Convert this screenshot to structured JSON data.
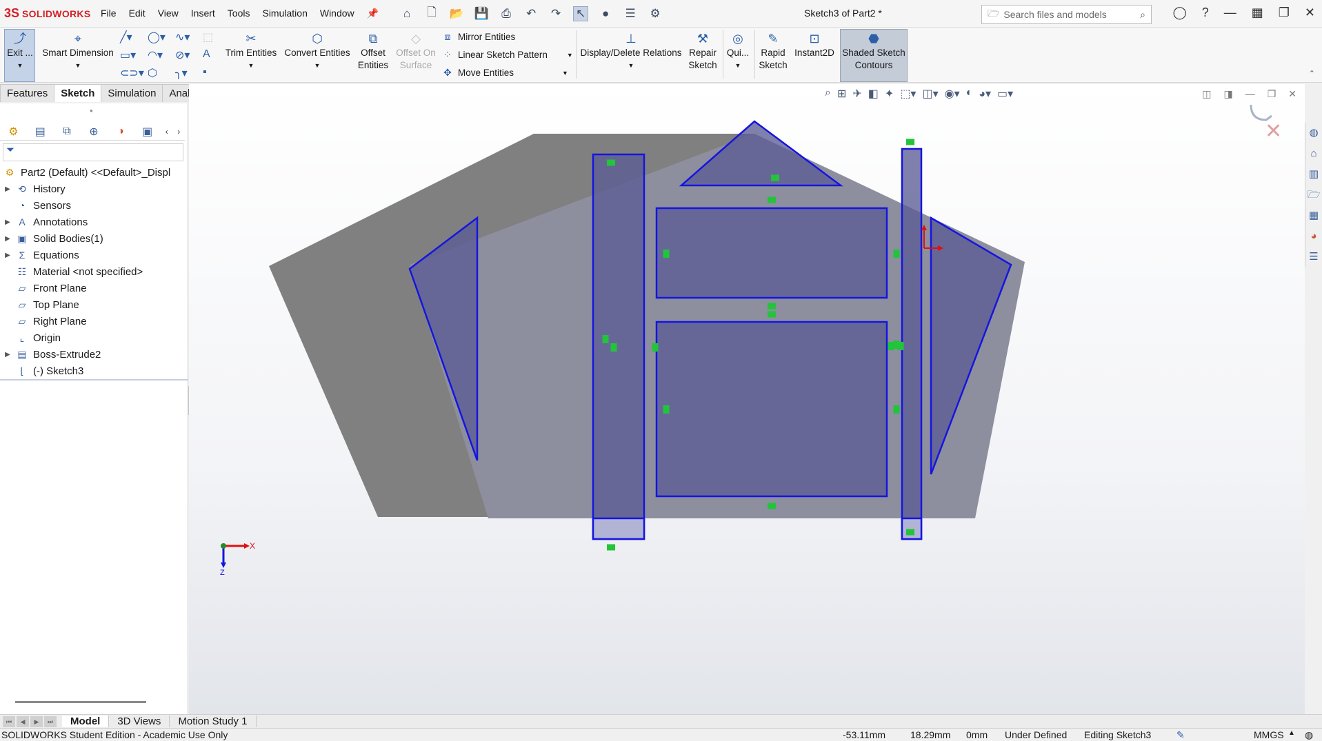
{
  "app": {
    "logo_mark": "3S",
    "logo_text": "SOLIDWORKS",
    "document_title": "Sketch3 of Part2 *"
  },
  "menu": [
    "File",
    "Edit",
    "View",
    "Insert",
    "Tools",
    "Simulation",
    "Window"
  ],
  "search": {
    "placeholder": "Search files and models"
  },
  "commands": {
    "exit": "Exit ...",
    "smart_dimension": "Smart Dimension",
    "trim_entities": "Trim Entities",
    "convert_entities": "Convert Entities",
    "offset_entities_1": "Offset",
    "offset_entities_2": "Entities",
    "offset_on_surface_1": "Offset On",
    "offset_on_surface_2": "Surface",
    "mirror_entities": "Mirror Entities",
    "linear_sketch_pattern": "Linear Sketch Pattern",
    "move_entities": "Move Entities",
    "display_delete_relations": "Display/Delete Relations",
    "repair_sketch_1": "Repair",
    "repair_sketch_2": "Sketch",
    "quick_snaps": "Qui...",
    "rapid_sketch_1": "Rapid",
    "rapid_sketch_2": "Sketch",
    "instant2d": "Instant2D",
    "shaded_contours_1": "Shaded Sketch",
    "shaded_contours_2": "Contours"
  },
  "tabs": [
    "Features",
    "Sketch",
    "Simulation",
    "Analysis Preparation"
  ],
  "active_tab": "Sketch",
  "tree": {
    "root": "Part2 (Default) <<Default>_Displ",
    "items": [
      {
        "label": "History",
        "expandable": true
      },
      {
        "label": "Sensors",
        "expandable": false
      },
      {
        "label": "Annotations",
        "expandable": true
      },
      {
        "label": "Solid Bodies(1)",
        "expandable": true
      },
      {
        "label": "Equations",
        "expandable": true
      },
      {
        "label": "Material <not specified>",
        "expandable": false
      },
      {
        "label": "Front Plane",
        "expandable": false
      },
      {
        "label": "Top Plane",
        "expandable": false
      },
      {
        "label": "Right Plane",
        "expandable": false
      },
      {
        "label": "Origin",
        "expandable": false
      },
      {
        "label": "Boss-Extrude2",
        "expandable": true
      },
      {
        "label": "(-) Sketch3",
        "expandable": false
      }
    ]
  },
  "triad": {
    "x_label": "X",
    "z_label": "Z"
  },
  "bottom_tabs": [
    "Model",
    "3D Views",
    "Motion Study 1"
  ],
  "status": {
    "edition": "SOLIDWORKS Student Edition - Academic Use Only",
    "x": "-53.11mm",
    "y": "18.29mm",
    "z": "0mm",
    "state": "Under Defined",
    "editing": "Editing Sketch3",
    "units": "MMGS"
  },
  "colors": {
    "sketch_line": "#1515e0",
    "sketch_fill": "#5b5c95",
    "relation_marker": "#22c43a",
    "shadow": "#808080",
    "body_face": "#8d8f9e",
    "accent": "#d42027"
  }
}
